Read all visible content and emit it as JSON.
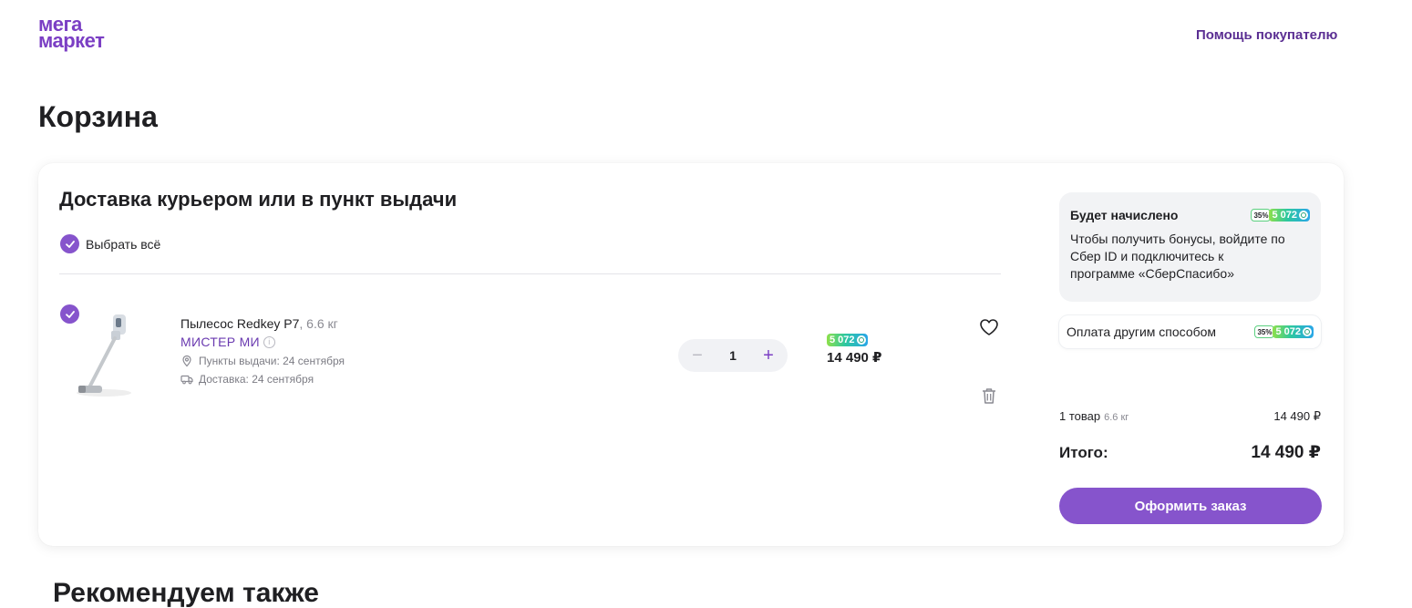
{
  "header": {
    "logo_line1": "мега",
    "logo_line2": "маркет",
    "help_link": "Помощь покупателю"
  },
  "page_title": "Корзина",
  "cart": {
    "section_title": "Доставка курьером или в пункт выдачи",
    "select_all_label": "Выбрать всё",
    "item": {
      "name": "Пылесос Redkey P7",
      "weight": ", 6.6 кг",
      "seller": "МИСТЕР МИ",
      "info_icon": "i",
      "pickup": "Пункты выдачи: 24 сентября",
      "delivery": "Доставка: 24 сентября",
      "quantity": "1",
      "minus": "−",
      "plus": "+",
      "bonus": "5 072",
      "price": "14 490 ₽"
    }
  },
  "side": {
    "bonus_title": "Будет начислено",
    "bonus_percent": "35%",
    "bonus_amount": "5 072",
    "bonus_desc": "Чтобы получить бонусы, войдите по Сбер ID и подключитесь к программе «СберСпасибо»",
    "pay_other": "Оплата другим способом",
    "pay_percent": "35%",
    "pay_amount": "5 072",
    "summary_label": "1 товар",
    "summary_weight": "6.6 кг",
    "summary_value": "14 490 ₽",
    "total_label": "Итого:",
    "total_value": "14 490 ₽",
    "checkout": "Оформить заказ"
  },
  "recommend_title": "Рекомендуем также",
  "colors": {
    "brand": "#7b3fc4",
    "button": "#8654cc"
  }
}
